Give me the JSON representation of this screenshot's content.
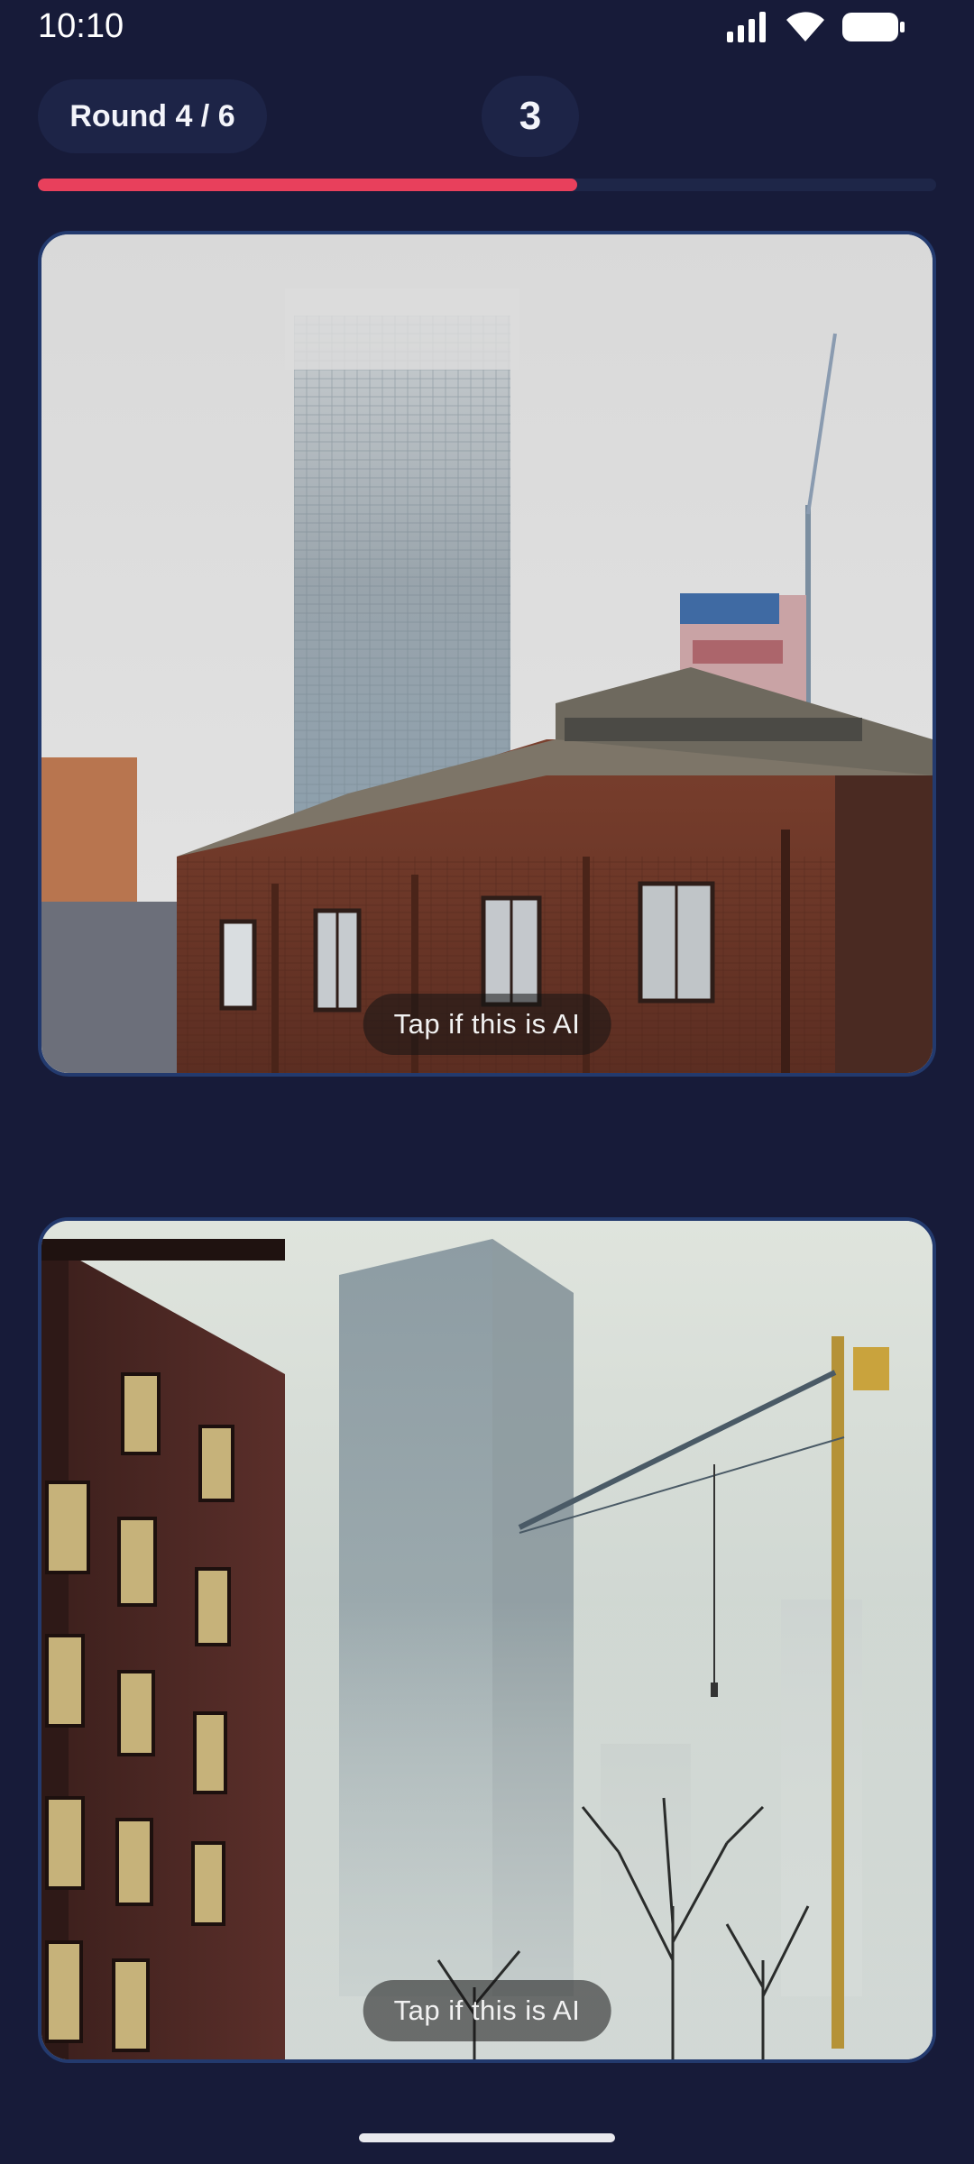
{
  "status_bar": {
    "time": "10:10"
  },
  "header": {
    "round_label": "Round 4 / 6",
    "timer_value": "3",
    "progress": 0.6
  },
  "cards": [
    {
      "tap_label": "Tap if this is AI"
    },
    {
      "tap_label": "Tap if this is AI"
    }
  ],
  "colors": {
    "background": "#171b39",
    "progress": "#e8405c",
    "card_border": "#233a6e"
  }
}
